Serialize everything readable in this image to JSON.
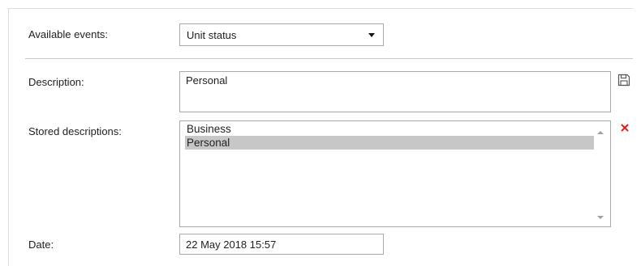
{
  "form": {
    "available_events": {
      "label": "Available events:",
      "selected": "Unit status"
    },
    "description": {
      "label": "Description:",
      "value": "Personal",
      "save_icon": "floppy-disk-icon"
    },
    "stored_descriptions": {
      "label": "Stored descriptions:",
      "items": [
        "Business",
        "Personal"
      ],
      "selected_item": "Personal",
      "delete_icon": "red-x-icon"
    },
    "date": {
      "label": "Date:",
      "value": "22 May 2018 15:57"
    }
  },
  "colors": {
    "selection_bg": "#c7c7c7",
    "delete_red": "#e0201c",
    "border": "#a9a9a9",
    "divider": "#c8c8c8"
  }
}
